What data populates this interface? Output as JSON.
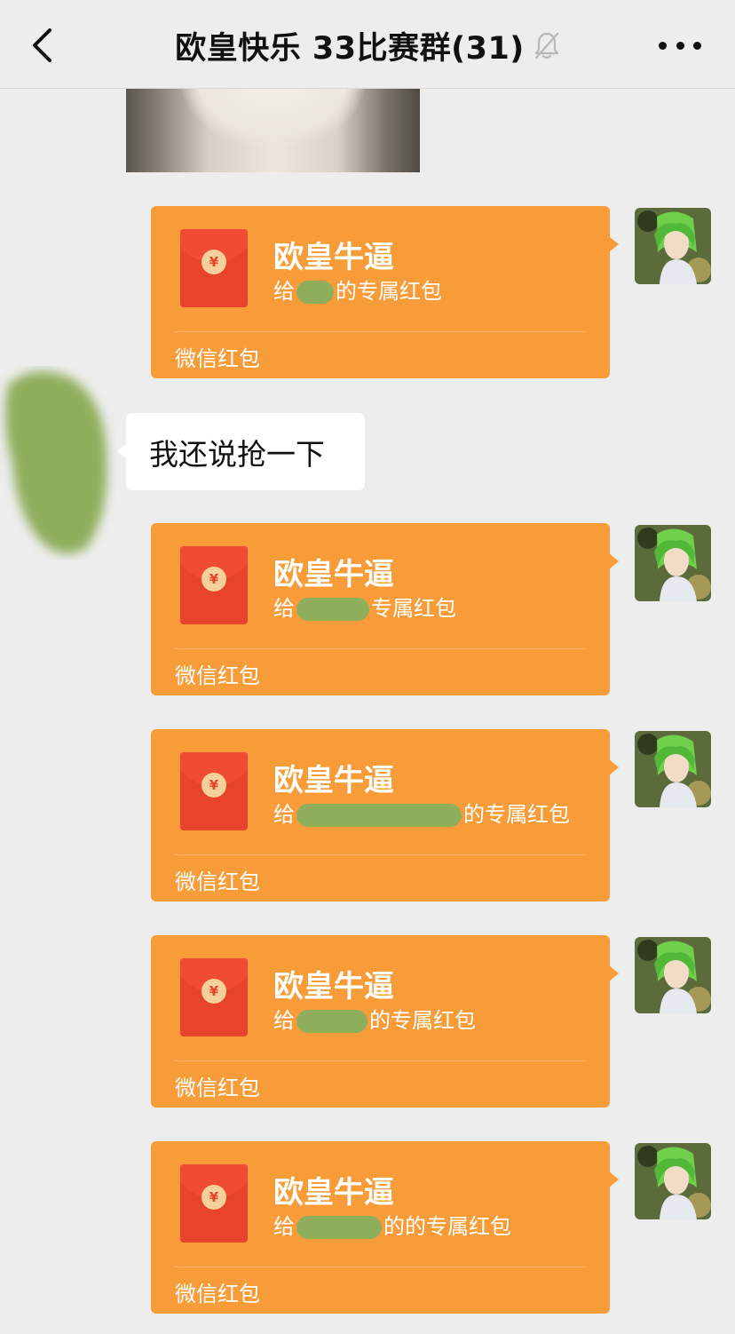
{
  "header": {
    "title": "欧皇快乐 33比赛群(31)",
    "back_icon": "chevron-left-icon",
    "mute_icon": "bell-off-icon",
    "more_icon": "more-dots-icon"
  },
  "messages": {
    "received_text": "我还说抢一下",
    "red_packets": [
      {
        "title": "欧皇牛逼",
        "sub_prefix": "给",
        "sub_suffix": "的专属红包",
        "footer": "微信红包"
      },
      {
        "title": "欧皇牛逼",
        "sub_prefix": "给",
        "sub_suffix": "专属红包",
        "footer": "微信红包"
      },
      {
        "title": "欧皇牛逼",
        "sub_prefix": "给",
        "sub_suffix": "的专属红包",
        "footer": "微信红包"
      },
      {
        "title": "欧皇牛逼",
        "sub_prefix": "给",
        "sub_suffix": "的专属红包",
        "footer": "微信红包"
      },
      {
        "title": "欧皇牛逼",
        "sub_prefix": "给",
        "sub_suffix": "的的专属红包",
        "footer": "微信红包"
      }
    ],
    "coin_symbol": "¥"
  },
  "colors": {
    "background": "#ededed",
    "red_packet": "#f79c38",
    "envelope": "#e8432d",
    "redaction": "#8fae5c"
  }
}
